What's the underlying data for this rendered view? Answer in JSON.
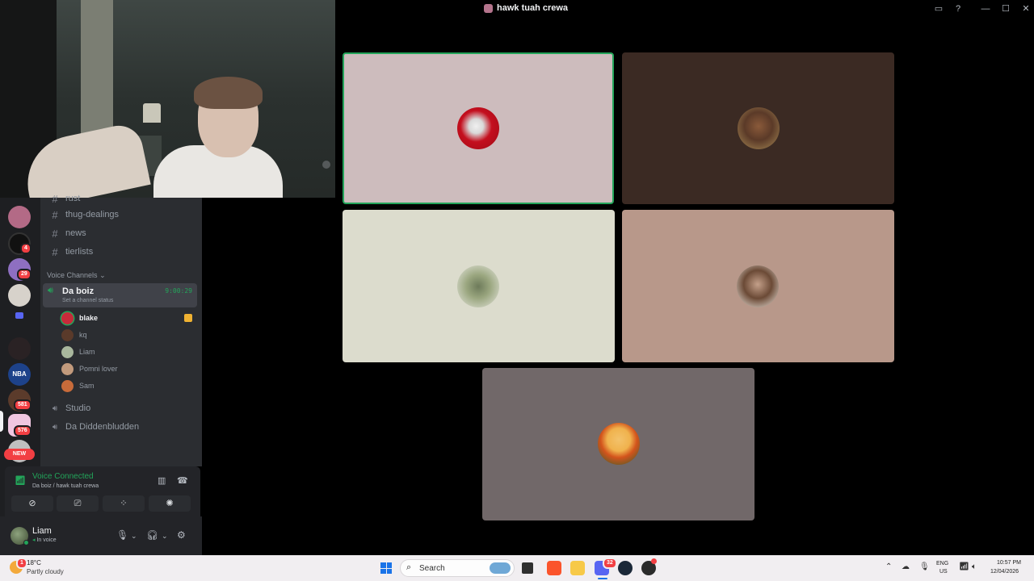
{
  "window": {
    "title": "hawk tuah crewa"
  },
  "rail": {
    "badges": [
      "4",
      "29",
      "581",
      "576"
    ],
    "new_label": "NEW",
    "nba_label": "NBA"
  },
  "sidebar": {
    "partial_channel": "rust",
    "text_channels": [
      "thug-dealings",
      "news",
      "tierlists"
    ],
    "voice_category": "Voice Channels",
    "active_voice": {
      "name": "Da boiz",
      "status": "Set a channel status",
      "timer": "9:00:29"
    },
    "members": [
      "blake",
      "kq",
      "Liam",
      "Pomni lover",
      "Sam"
    ],
    "other_voice": [
      "Studio",
      "Da Diddenbludden"
    ]
  },
  "voice_panel": {
    "title": "Voice Connected",
    "subtitle": "Da boiz / hawk tuah crewa"
  },
  "user_panel": {
    "name": "Liam",
    "status": "In voice"
  },
  "taskbar": {
    "weather_temp": "18°C",
    "weather_desc": "Partly cloudy",
    "weather_badge": "1",
    "search_label": "Search",
    "lang1": "ENG",
    "lang2": "US",
    "time": "10:57 PM",
    "date": "12/04/2026",
    "discord_badge": "32"
  },
  "colors": {
    "accent_green": "#23a55a",
    "badge_red": "#f23f43",
    "sidebar_bg": "#2b2d31"
  }
}
